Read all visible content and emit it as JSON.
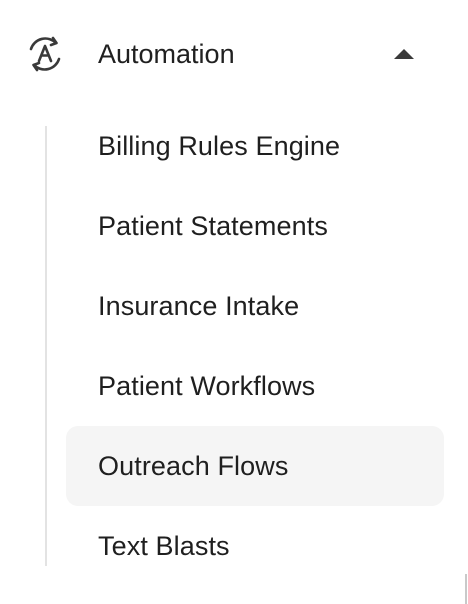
{
  "section": {
    "title": "Automation",
    "icon": "automation-icon",
    "expanded": true,
    "toggle_icon": "chevron-up-icon"
  },
  "submenu": {
    "items": [
      {
        "label": "Billing Rules Engine",
        "active": false
      },
      {
        "label": "Patient Statements",
        "active": false
      },
      {
        "label": "Insurance Intake",
        "active": false
      },
      {
        "label": "Patient Workflows",
        "active": false
      },
      {
        "label": "Outreach Flows",
        "active": true
      },
      {
        "label": "Text Blasts",
        "active": false
      }
    ]
  },
  "colors": {
    "text": "#1f1f1f",
    "icon": "#3a3a3a",
    "active_background": "#f5f5f5",
    "rail": "#e3e3e3"
  }
}
